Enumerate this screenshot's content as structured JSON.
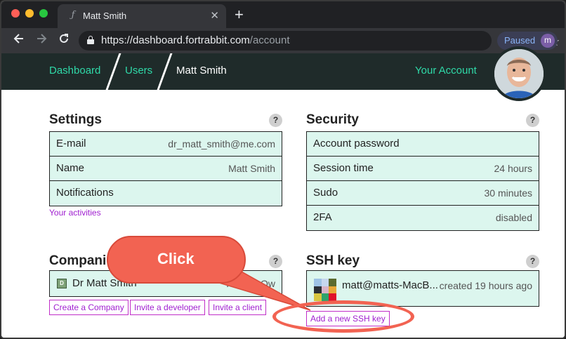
{
  "browser": {
    "tab_title": "Matt Smith",
    "tab_favicon": "ƒ",
    "close_glyph": "✕",
    "new_tab_glyph": "+",
    "url_host": "https://dashboard.fortrabbit.com",
    "url_path": "/account",
    "paused_label": "Paused",
    "profile_initial": "m"
  },
  "header": {
    "breadcrumbs": [
      "Dashboard",
      "Users",
      "Matt Smith"
    ],
    "your_account": "Your Account"
  },
  "settings": {
    "title": "Settings",
    "help": "?",
    "rows": [
      {
        "label": "E-mail",
        "value": "dr_matt_smith@me.com"
      },
      {
        "label": "Name",
        "value": "Matt Smith"
      },
      {
        "label": "Notifications",
        "value": ""
      }
    ],
    "activities_link": "Your activities"
  },
  "security": {
    "title": "Security",
    "help": "?",
    "rows": [
      {
        "label": "Account password",
        "value": ""
      },
      {
        "label": "Session time",
        "value": "24 hours"
      },
      {
        "label": "Sudo",
        "value": "30 minutes"
      },
      {
        "label": "2FA",
        "value": "disabled"
      }
    ]
  },
  "companies": {
    "title": "Compani",
    "help": "?",
    "badge": "D",
    "company_name": "Dr Matt Smith",
    "role": "You are Ow",
    "buttons": [
      "Create a Company",
      "Invite a developer",
      "Invite a client"
    ]
  },
  "ssh": {
    "title": "SSH key",
    "help": "?",
    "key_name": "matt@matts-MacB...",
    "created": "created 19 hours ago",
    "add_button": "Add a new SSH key",
    "identicon_colors": [
      "#9ec3e6",
      "#c6d7ee",
      "#5b6b2f",
      "#2b2f36",
      "#d9b3c6",
      "#e8a838",
      "#d9c640",
      "#2fa36b",
      "#e0112b"
    ]
  },
  "callout": {
    "text": "Click"
  }
}
